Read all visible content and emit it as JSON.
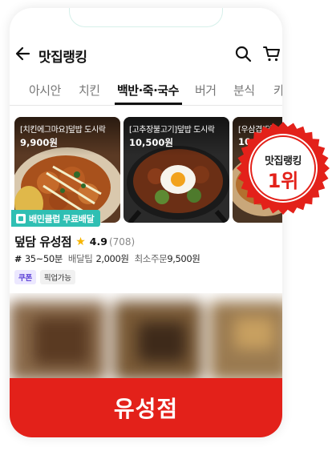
{
  "header": {
    "title": "맛집랭킹"
  },
  "tabs": [
    {
      "label": "아시안"
    },
    {
      "label": "치킨"
    },
    {
      "label": "백반·죽·국수"
    },
    {
      "label": "버거"
    },
    {
      "label": "분식"
    },
    {
      "label": "카"
    }
  ],
  "menu_cards": [
    {
      "name": "[치킨에그마요]덮밥 도시락",
      "price": "9,900원"
    },
    {
      "name": "[고추장불고기]덮밥 도시락",
      "price": "10,500원"
    },
    {
      "name": "[우삼겹]덮",
      "price": "10,"
    }
  ],
  "store": {
    "club_badge": "배민클럽 무료배달",
    "name": "덮담 유성점",
    "rating": "4.9",
    "review_count": "(708)",
    "delivery_time": "35~50분",
    "delivery_tip_label": "배달팁",
    "delivery_tip": "2,000원",
    "min_order_label": "최소주문",
    "min_order": "9,500원",
    "tags": [
      "쿠폰",
      "픽업가능"
    ]
  },
  "rank_seal": {
    "line1": "맛집랭킹",
    "line2": "1위"
  },
  "banner": {
    "text": "유성점"
  },
  "colors": {
    "accent": "#e3211a",
    "club": "#2fbfb3",
    "coupon": "#5a3fd6"
  }
}
